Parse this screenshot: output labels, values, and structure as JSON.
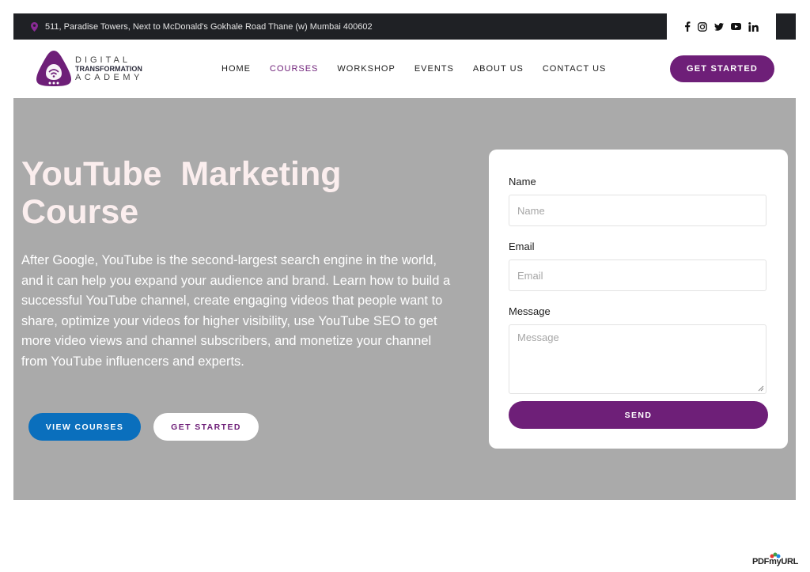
{
  "topbar": {
    "address": "511, Paradise Towers, Next to McDonald's Gokhale Road Thane (w) Mumbai 400602",
    "social_icons": [
      "facebook-icon",
      "instagram-icon",
      "twitter-icon",
      "youtube-icon",
      "linkedin-icon"
    ]
  },
  "logo": {
    "line1": "DIGITAL",
    "line2": "TRANSFORMATION",
    "line3": "ACADEMY"
  },
  "nav": {
    "items": [
      {
        "label": "HOME",
        "active": false
      },
      {
        "label": "COURSES",
        "active": true
      },
      {
        "label": "WORKSHOP",
        "active": false
      },
      {
        "label": "EVENTS",
        "active": false
      },
      {
        "label": "ABOUT US",
        "active": false
      },
      {
        "label": "CONTACT US",
        "active": false
      }
    ],
    "cta": "GET STARTED"
  },
  "hero": {
    "title": "YouTube  Marketing\nCourse",
    "description": "After Google, YouTube is the second-largest search engine in the world, and it can help you expand your audience and brand. Learn how to build a successful YouTube channel, create engaging videos that people want to share, optimize your videos for higher visibility, use YouTube SEO to get more video views and channel subscribers, and monetize your channel from YouTube influencers and experts.",
    "primary_button": "VIEW COURSES",
    "secondary_button": "GET STARTED"
  },
  "form": {
    "name_label": "Name",
    "name_placeholder": "Name",
    "email_label": "Email",
    "email_placeholder": "Email",
    "message_label": "Message",
    "message_placeholder": "Message",
    "submit": "SEND"
  },
  "watermark": "PDFmyURL",
  "colors": {
    "brand": "#6e1f78",
    "primary_button": "#0a6fbd",
    "hero_bg": "#aaaaaa",
    "topbar_bg": "#1f2125"
  }
}
